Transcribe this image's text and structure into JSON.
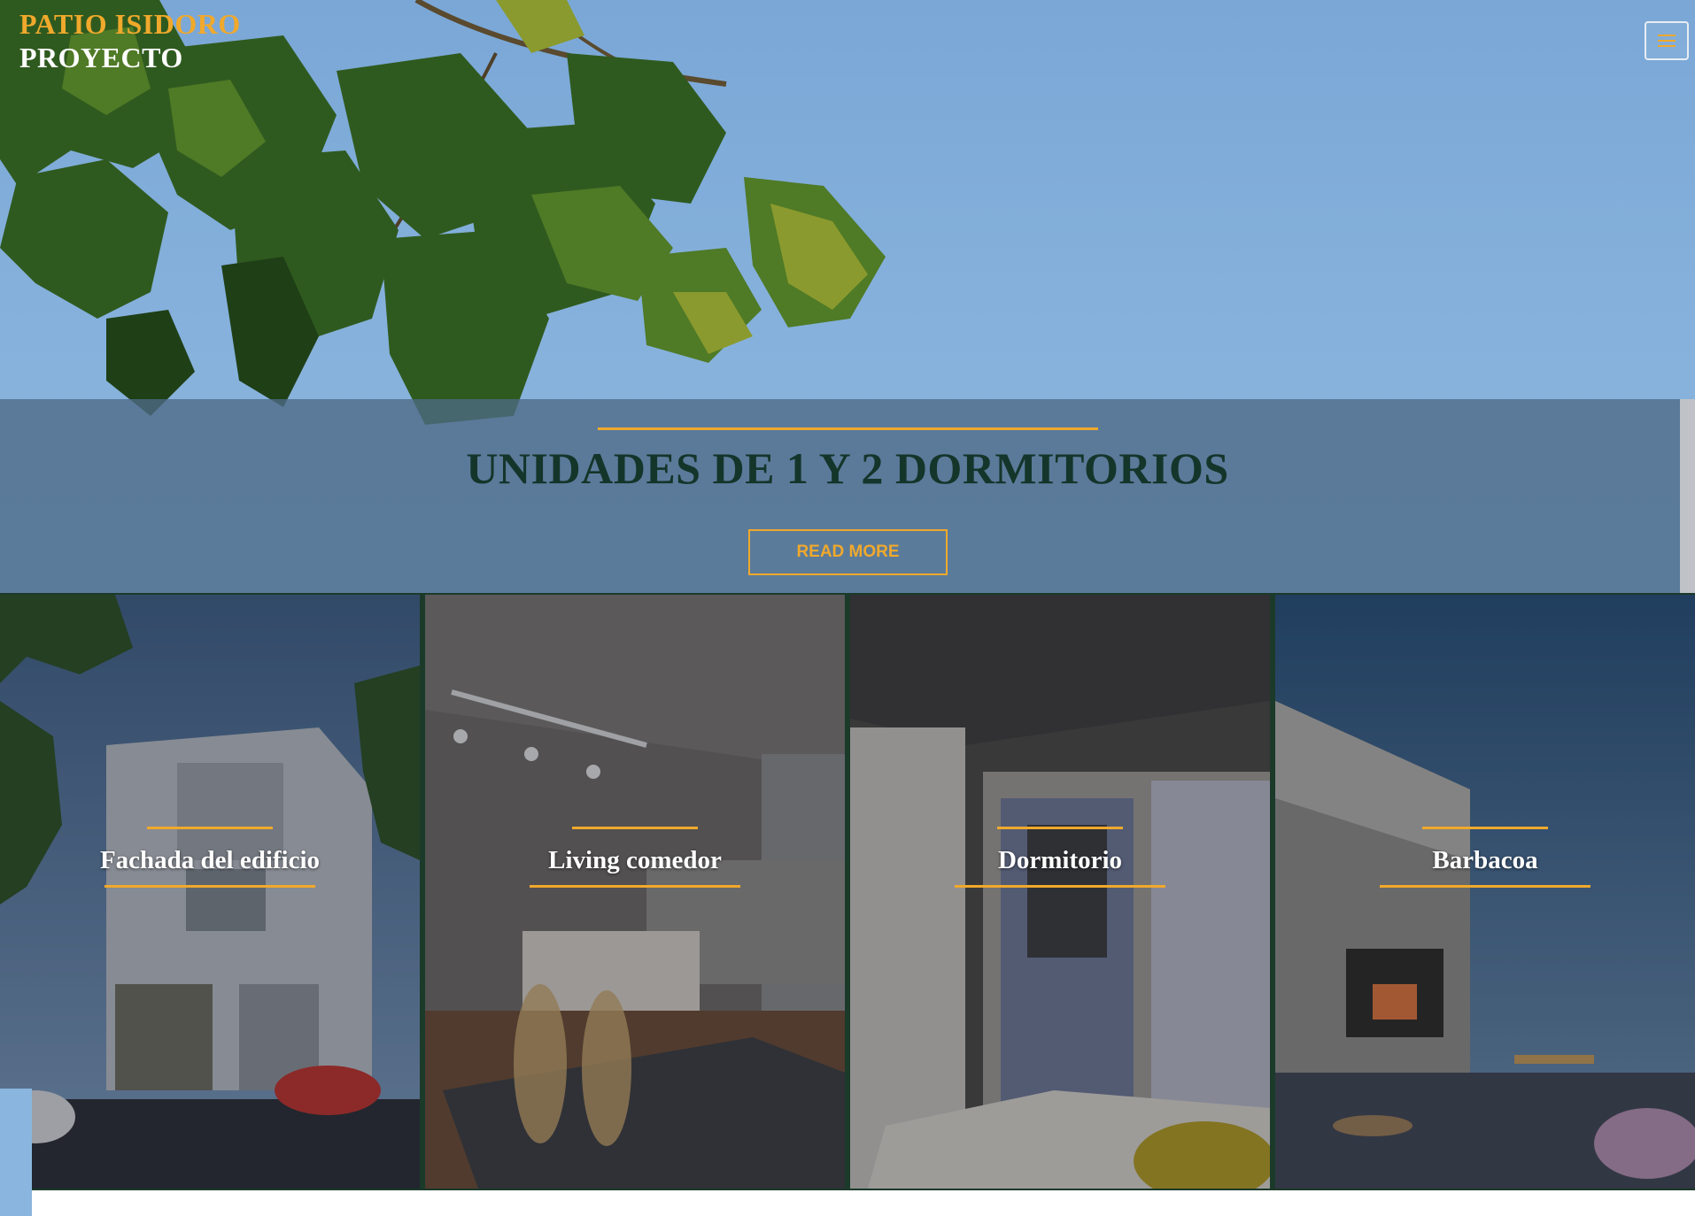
{
  "colors": {
    "accent": "#f0a92c",
    "title_text": "#14352a",
    "gallery_divider": "#1b3a2a"
  },
  "header": {
    "brand_line1": "PATIO ISIDORO",
    "brand_line2": "PROYECTO",
    "menu_icon": "hamburger-icon"
  },
  "band": {
    "title": "UNIDADES DE 1 Y 2 DORMITORIOS",
    "button_label": "READ MORE"
  },
  "gallery": {
    "items": [
      {
        "title": "Fachada del edificio"
      },
      {
        "title": "Living comedor"
      },
      {
        "title": "Dormitorio"
      },
      {
        "title": "Barbacoa"
      }
    ]
  }
}
